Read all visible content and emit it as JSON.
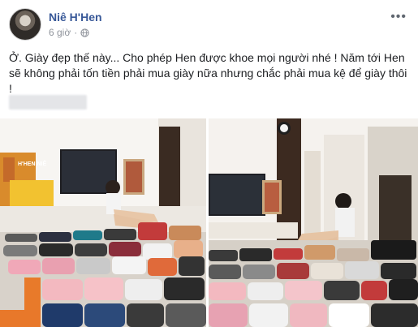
{
  "post": {
    "author": "Niê H'Hen",
    "timestamp": "6 giờ",
    "separator": "·",
    "privacy_icon": "globe-icon",
    "more_label": "•••",
    "text": "Ở. Giày đẹp thế này... Cho phép Hen được khoe mọi người nhé ! Năm tới Hen sẽ không phải tốn tiền phải mua giày nữa nhưng chắc phải mua kệ để giày thôi !",
    "poster_text": "H'HEN NIÊ",
    "colors": {
      "link": "#385898",
      "meta": "#90949c",
      "text": "#1c1e21"
    }
  }
}
